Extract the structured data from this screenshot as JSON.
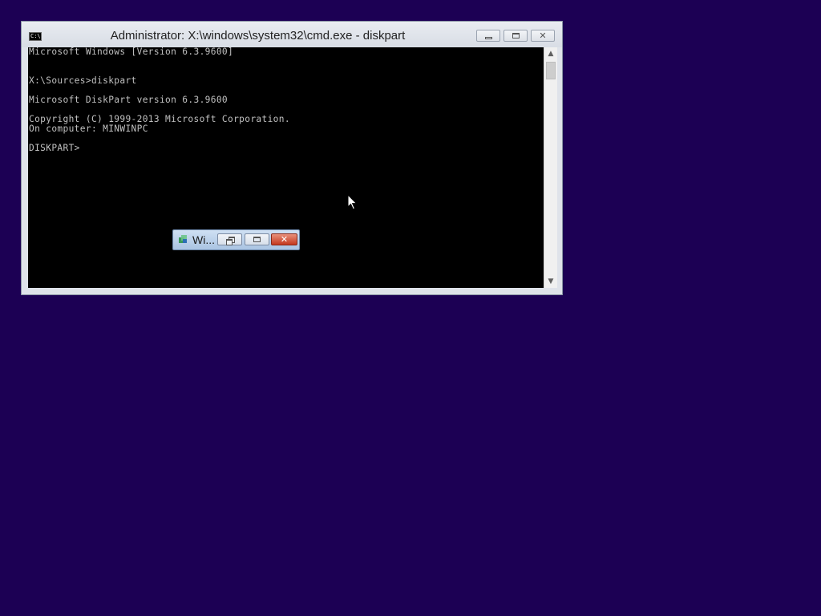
{
  "cmd_window": {
    "title": "Administrator: X:\\windows\\system32\\cmd.exe - diskpart",
    "icon": "cmd-icon",
    "icon_text": "C:\\.",
    "console_lines": [
      "Microsoft Windows [Version 6.3.9600]",
      "",
      "X:\\Sources>diskpart",
      "",
      "Microsoft DiskPart version 6.3.9600",
      "",
      "Copyright (C) 1999-2013 Microsoft Corporation.",
      "On computer: MINWINPC",
      "",
      "DISKPART>"
    ]
  },
  "mini_window": {
    "title": "Wi...",
    "icon": "setup-icon"
  },
  "colors": {
    "desktop_background": "#1c0054",
    "console_background": "#000000",
    "console_text": "#c0c0c0"
  }
}
